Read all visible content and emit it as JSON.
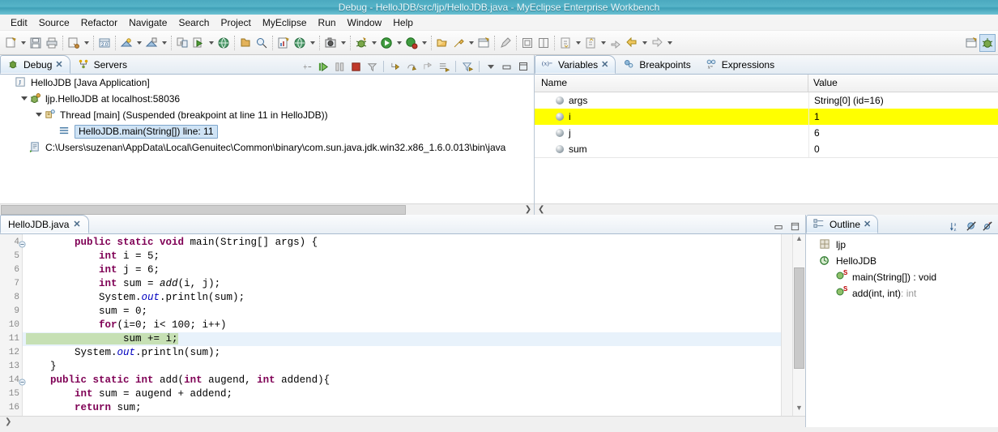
{
  "window": {
    "title": "Debug - HelloJDB/src/ljp/HelloJDB.java - MyEclipse Enterprise Workbench"
  },
  "menu": {
    "items": [
      {
        "label": "Edit"
      },
      {
        "label": "Source"
      },
      {
        "label": "Refactor"
      },
      {
        "label": "Navigate"
      },
      {
        "label": "Search"
      },
      {
        "label": "Project"
      },
      {
        "label": "MyEclipse"
      },
      {
        "label": "Run"
      },
      {
        "label": "Window"
      },
      {
        "label": "Help"
      }
    ]
  },
  "toolbar": {
    "groups": [
      [
        "new-wizard-icon",
        "dropdown",
        "save-icon",
        "print-icon"
      ],
      [
        "build-icon",
        "dropdown"
      ],
      [
        "deploy-icon"
      ],
      [
        "run-server-icon",
        "dropdown",
        "stop-server-icon",
        "dropdown"
      ],
      [
        "new-jsp-icon",
        "run-jsp-icon",
        "dropdown",
        "browser-icon"
      ],
      [
        "open-type-icon",
        "search-icon"
      ],
      [
        "report-icon",
        "web-browser-icon",
        "dropdown"
      ],
      [
        "snapshot-icon",
        "dropdown"
      ],
      [
        "debug-icon",
        "dropdown",
        "run-icon",
        "dropdown",
        "coverage-icon",
        "dropdown"
      ],
      [
        "open-folder-icon",
        "external-tools-icon",
        "dropdown",
        "open-perspective-icon"
      ],
      [
        "annotate-icon"
      ],
      [
        "toggle-block-icon",
        "toggle-column-icon"
      ],
      [
        "next-annotation-icon",
        "dropdown",
        "previous-annotation-icon",
        "dropdown",
        "last-edit-icon",
        "back-icon",
        "dropdown",
        "forward-icon",
        "dropdown"
      ]
    ],
    "perspective_buttons": [
      "open-perspective-icon",
      "debug-perspective-icon"
    ]
  },
  "debug_view": {
    "tabs": [
      {
        "label": "Debug",
        "icon": "debug-tab-icon",
        "active": true,
        "closable": true
      },
      {
        "label": "Servers",
        "icon": "servers-tab-icon",
        "active": false,
        "closable": false
      }
    ],
    "tools": [
      "disconnect-icon",
      "resume-icon",
      "suspend-icon",
      "terminate-icon",
      "step-filters-icon",
      "step-into-icon",
      "step-over-icon",
      "step-return-icon",
      "drop-to-frame-icon",
      "use-step-filters-icon",
      "view-menu-icon",
      "minimize-icon",
      "maximize-icon"
    ],
    "tree": [
      {
        "indent": 0,
        "twisty": "none",
        "icon": "java-application-icon",
        "label": "HelloJDB [Java Application]",
        "selected": false
      },
      {
        "indent": 1,
        "twisty": "open",
        "icon": "debug-target-icon",
        "label": "ljp.HelloJDB at localhost:58036",
        "selected": false
      },
      {
        "indent": 2,
        "twisty": "open",
        "icon": "thread-icon",
        "label": "Thread [main] (Suspended (breakpoint at line 11 in HelloJDB))",
        "selected": false
      },
      {
        "indent": 3,
        "twisty": "none",
        "icon": "stack-frame-icon",
        "label": "HelloJDB.main(String[]) line: 11",
        "selected": true
      },
      {
        "indent": 1,
        "twisty": "none",
        "icon": "process-icon",
        "label": "C:\\Users\\suzenan\\AppData\\Local\\Genuitec\\Common\\binary\\com.sun.java.jdk.win32.x86_1.6.0.013\\bin\\java",
        "selected": false
      }
    ]
  },
  "variables_view": {
    "tabs": [
      {
        "label": "Variables",
        "icon": "variables-tab-icon",
        "active": true,
        "closable": true
      },
      {
        "label": "Breakpoints",
        "icon": "breakpoints-tab-icon",
        "active": false,
        "closable": false
      },
      {
        "label": "Expressions",
        "icon": "expressions-tab-icon",
        "active": false,
        "closable": false
      }
    ],
    "columns": [
      "Name",
      "Value"
    ],
    "rows": [
      {
        "name": "args",
        "value": "String[0]  (id=16)",
        "highlighted": false
      },
      {
        "name": "i",
        "value": "1",
        "highlighted": true
      },
      {
        "name": "j",
        "value": "6",
        "highlighted": false
      },
      {
        "name": "sum",
        "value": "0",
        "highlighted": false
      }
    ]
  },
  "editor": {
    "tab": {
      "label": "HelloJDB.java",
      "closable": true
    },
    "lines": [
      {
        "num": "4",
        "fold": true,
        "current": false,
        "tokens": [
          {
            "t": "        ",
            "c": ""
          },
          {
            "t": "public static void ",
            "c": "kw"
          },
          {
            "t": "main(String[] args) {",
            "c": ""
          }
        ]
      },
      {
        "num": "5",
        "fold": false,
        "current": false,
        "tokens": [
          {
            "t": "            ",
            "c": ""
          },
          {
            "t": "int",
            "c": "kw"
          },
          {
            "t": " i = 5;",
            "c": ""
          }
        ]
      },
      {
        "num": "6",
        "fold": false,
        "current": false,
        "tokens": [
          {
            "t": "            ",
            "c": ""
          },
          {
            "t": "int",
            "c": "kw"
          },
          {
            "t": " j = 6;",
            "c": ""
          }
        ]
      },
      {
        "num": "7",
        "fold": false,
        "current": false,
        "tokens": [
          {
            "t": "            ",
            "c": ""
          },
          {
            "t": "int",
            "c": "kw"
          },
          {
            "t": " sum = ",
            "c": ""
          },
          {
            "t": "add",
            "c": "meth"
          },
          {
            "t": "(i, j);",
            "c": ""
          }
        ]
      },
      {
        "num": "8",
        "fold": false,
        "current": false,
        "tokens": [
          {
            "t": "            System.",
            "c": ""
          },
          {
            "t": "out",
            "c": "fld"
          },
          {
            "t": ".println(sum);",
            "c": ""
          }
        ]
      },
      {
        "num": "9",
        "fold": false,
        "current": false,
        "tokens": [
          {
            "t": "            sum = 0;",
            "c": ""
          }
        ]
      },
      {
        "num": "10",
        "fold": false,
        "current": false,
        "tokens": [
          {
            "t": "            ",
            "c": ""
          },
          {
            "t": "for",
            "c": "kw"
          },
          {
            "t": "(i=0; i< 100; i++)",
            "c": ""
          }
        ]
      },
      {
        "num": "11",
        "fold": false,
        "current": true,
        "tokens": [
          {
            "t": "                sum += i;",
            "c": "hl"
          }
        ]
      },
      {
        "num": "12",
        "fold": false,
        "current": false,
        "tokens": [
          {
            "t": "        System.",
            "c": ""
          },
          {
            "t": "out",
            "c": "fld"
          },
          {
            "t": ".println(sum);",
            "c": ""
          }
        ]
      },
      {
        "num": "13",
        "fold": false,
        "current": false,
        "tokens": [
          {
            "t": "    }",
            "c": ""
          }
        ]
      },
      {
        "num": "14",
        "fold": true,
        "current": false,
        "tokens": [
          {
            "t": "    ",
            "c": ""
          },
          {
            "t": "public static int ",
            "c": "kw"
          },
          {
            "t": "add(",
            "c": ""
          },
          {
            "t": "int",
            "c": "kw"
          },
          {
            "t": " augend, ",
            "c": ""
          },
          {
            "t": "int",
            "c": "kw"
          },
          {
            "t": " addend){",
            "c": ""
          }
        ]
      },
      {
        "num": "15",
        "fold": false,
        "current": false,
        "tokens": [
          {
            "t": "        ",
            "c": ""
          },
          {
            "t": "int",
            "c": "kw"
          },
          {
            "t": " sum = augend + addend;",
            "c": ""
          }
        ]
      },
      {
        "num": "16",
        "fold": false,
        "current": false,
        "tokens": [
          {
            "t": "        ",
            "c": ""
          },
          {
            "t": "return",
            "c": "kw"
          },
          {
            "t": " sum;",
            "c": ""
          }
        ]
      }
    ],
    "scroll_arrow_up": "▲",
    "scroll_arrow_down": "▼",
    "hscroll_arrow": "❯"
  },
  "outline_view": {
    "tab": {
      "label": "Outline",
      "icon": "outline-tab-icon",
      "closable": true
    },
    "tools": [
      "sort-icon",
      "hide-fields-icon",
      "hide-static-icon"
    ],
    "rows": [
      {
        "indent": 0,
        "icon": "package-icon",
        "label": "ljp",
        "suffix": "",
        "static": false
      },
      {
        "indent": 0,
        "icon": "class-icon",
        "label": "HelloJDB",
        "suffix": "",
        "static": false
      },
      {
        "indent": 1,
        "icon": "method-icon",
        "label": "main(String[]) : void",
        "suffix": "",
        "static": true
      },
      {
        "indent": 1,
        "icon": "method-icon",
        "label": "add(int, int)",
        "suffix": " : int",
        "static": true
      }
    ]
  },
  "colors": {
    "title_bar": "#56b4c8",
    "highlight_row": "#ffff00",
    "current_line_bg": "#e8f2fb",
    "current_line_exec": "#c6e0b4",
    "selection": "#cfe3f5",
    "keyword": "#7f0055",
    "field": "#0000c0"
  }
}
